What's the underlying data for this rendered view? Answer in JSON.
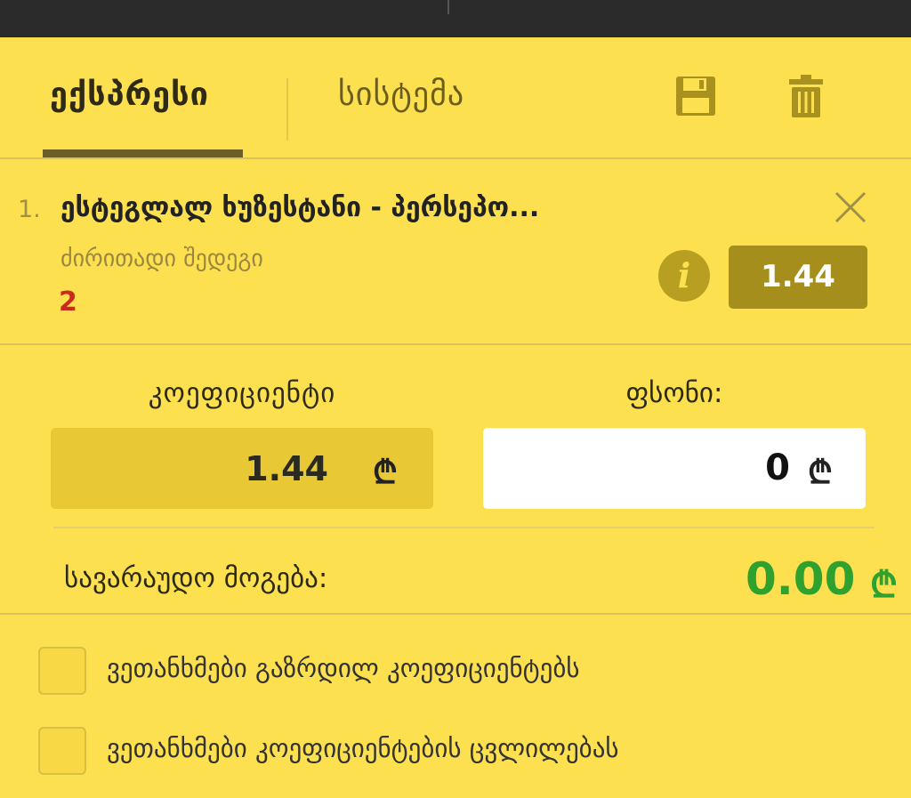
{
  "tabs": [
    {
      "label": "ექსპრესი",
      "active": true
    },
    {
      "label": "სისტემა",
      "active": false
    }
  ],
  "toolbar": {
    "save_icon": "save-icon",
    "trash_icon": "trash-icon"
  },
  "bet": {
    "index": "1.",
    "title": "ესტეგლალ ხუზესტანი - პერსეპო...",
    "market": "ძირითადი შედეგი",
    "pick": "2",
    "odds": "1.44"
  },
  "summary": {
    "coef_label": "კოეფიციენტი",
    "coef_value": "1.44",
    "stake_label": "ფსონი:",
    "stake_value": "0",
    "currency": "₾",
    "potential_label": "სავარაუდო მოგება:",
    "potential_value": "0.00"
  },
  "options": [
    {
      "label": "ვეთანხმები გაზრდილ კოეფიციენტებს",
      "checked": false
    },
    {
      "label": "ვეთანხმები კოეფიციენტების ცვლილებას",
      "checked": false
    }
  ],
  "colors": {
    "background": "#fde04f",
    "accent": "#a58e1b",
    "win": "#2fa12f",
    "pick": "#cc2a1a"
  }
}
